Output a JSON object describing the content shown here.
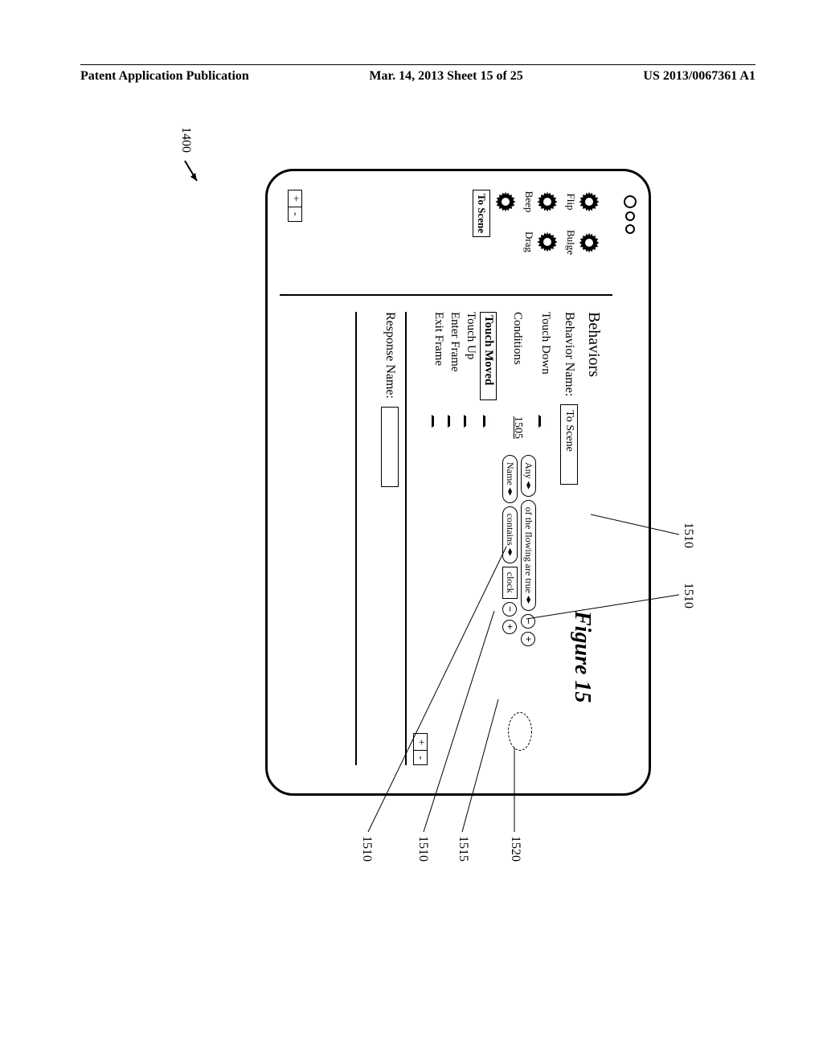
{
  "header": {
    "left": "Patent Application Publication",
    "middle": "Mar. 14, 2013  Sheet 15 of 25",
    "right": "US 2013/0067361 A1"
  },
  "figure": {
    "label": "Figure 15",
    "device_label": "1400"
  },
  "callouts": {
    "c1510a": "1510",
    "c1510b": "1510",
    "c1520": "1520",
    "c1515": "1515",
    "c1510c": "1510",
    "c1510d": "1510",
    "c1505": "1505"
  },
  "left_panel": {
    "items": [
      {
        "label": "Flip"
      },
      {
        "label": "Bulge"
      },
      {
        "label": "Beep"
      },
      {
        "label": "Drag"
      }
    ],
    "single_gear": true,
    "selected": "To Scene"
  },
  "right_panel": {
    "title": "Behaviors",
    "behavior_name_label": "Behavior Name:",
    "behavior_name_value": "To Scene",
    "events": {
      "touch_down": "Touch Down",
      "conditions_label": "Conditions",
      "touch_moved": "Touch Moved",
      "touch_up": "Touch Up",
      "enter_frame": "Enter Frame",
      "exit_frame": "Exit Frame"
    },
    "condition1": {
      "pill1": "Any",
      "text": "of the flowing are true"
    },
    "condition2": {
      "pill1": "Name",
      "pill2": "contains",
      "value": "clock"
    },
    "response_name_label": "Response Name:"
  }
}
